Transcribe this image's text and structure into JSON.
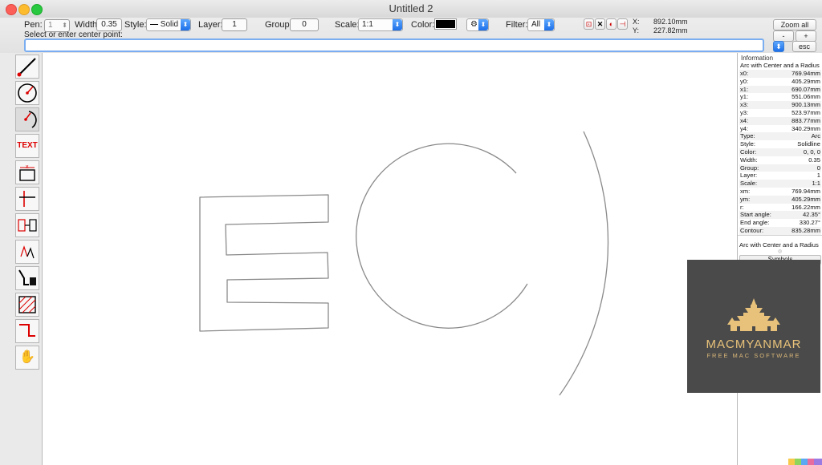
{
  "window": {
    "title": "Untitled 2"
  },
  "toolbar": {
    "pen_label": "Pen:",
    "pen_value": "1",
    "width_label": "Width:",
    "width_value": "0.35",
    "style_label": "Style:",
    "style_value": "Solid",
    "layer_label": "Layer:",
    "layer_value": "1",
    "group_label": "Group:",
    "group_value": "0",
    "scale_label": "Scale:",
    "scale_value": "1:1",
    "color_label": "Color:",
    "color_value": "#000000",
    "filter_label": "Filter:",
    "filter_value": "All",
    "x_label": "X:",
    "x_value": "892.10mm",
    "y_label": "Y:",
    "y_value": "227.82mm",
    "zoom_all": "Zoom all",
    "zoom_minus": "-",
    "zoom_plus": "+",
    "esc": "esc",
    "prompt": "Select or enter center point:"
  },
  "tools": [
    {
      "name": "line-tool-icon"
    },
    {
      "name": "circle-tool-icon"
    },
    {
      "name": "arc-tool-icon"
    },
    {
      "name": "text-tool-icon",
      "label": "TEXT"
    },
    {
      "name": "dimension-tool-icon"
    },
    {
      "name": "trim-tool-icon"
    },
    {
      "name": "copy-tool-icon"
    },
    {
      "name": "edit-tool-icon"
    },
    {
      "name": "delete-tool-icon"
    },
    {
      "name": "hatch-tool-icon"
    },
    {
      "name": "polyline-tool-icon"
    },
    {
      "name": "hand-tool-icon"
    }
  ],
  "info": {
    "title": "Information",
    "subtitle": "Arc with Center and a Radius",
    "rows": [
      {
        "k": "x0:",
        "v": "769.94mm"
      },
      {
        "k": "y0:",
        "v": "405.29mm"
      },
      {
        "k": "x1:",
        "v": "690.07mm"
      },
      {
        "k": "y1:",
        "v": "551.06mm"
      },
      {
        "k": "x3:",
        "v": "900.13mm"
      },
      {
        "k": "y3:",
        "v": "523.97mm"
      },
      {
        "k": "x4:",
        "v": "883.77mm"
      },
      {
        "k": "y4:",
        "v": "340.29mm"
      },
      {
        "k": "Type:",
        "v": "Arc"
      },
      {
        "k": "Style:",
        "v": "Solidline"
      },
      {
        "k": "Color:",
        "v": "0, 0, 0"
      },
      {
        "k": "Width:",
        "v": "0.35"
      },
      {
        "k": "Group:",
        "v": "0"
      },
      {
        "k": "Layer:",
        "v": "1"
      },
      {
        "k": "Scale:",
        "v": "1:1"
      },
      {
        "k": "xm:",
        "v": "769.94mm"
      },
      {
        "k": "ym:",
        "v": "405.29mm"
      },
      {
        "k": "r:",
        "v": "166.22mm"
      },
      {
        "k": "Start angle:",
        "v": "42.35°"
      },
      {
        "k": "End angle:",
        "v": "330.27°"
      },
      {
        "k": "Contour:",
        "v": "835.28mm"
      }
    ],
    "footer": "Arc with Center and a Radius",
    "symbols_tab": "Symbols"
  },
  "watermark": {
    "brand": "MACMYANMAR",
    "tagline": "FREE MAC SOFTWARE",
    "bg_color": "#4a4a4a",
    "accent_color": "#e8c27a"
  }
}
